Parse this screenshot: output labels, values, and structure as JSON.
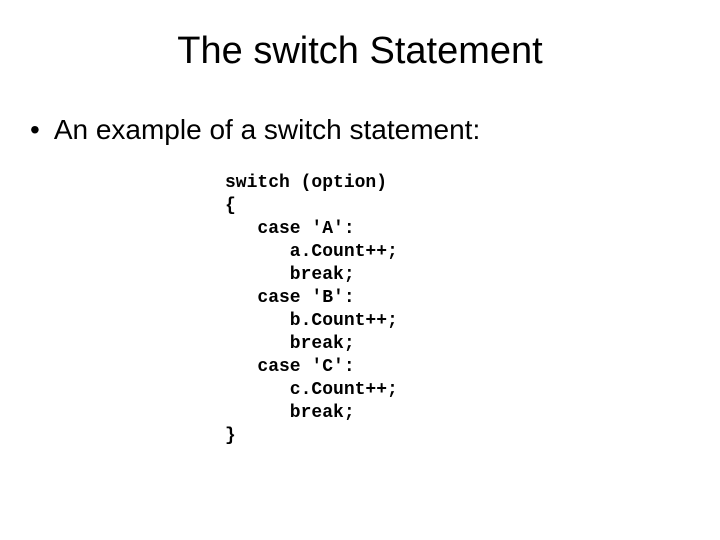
{
  "title": "The switch Statement",
  "bullet": "An example of a switch statement:",
  "code": "switch (option)\n{\n   case 'A':\n      a.Count++;\n      break;\n   case 'B':\n      b.Count++;\n      break;\n   case 'C':\n      c.Count++;\n      break;\n}"
}
